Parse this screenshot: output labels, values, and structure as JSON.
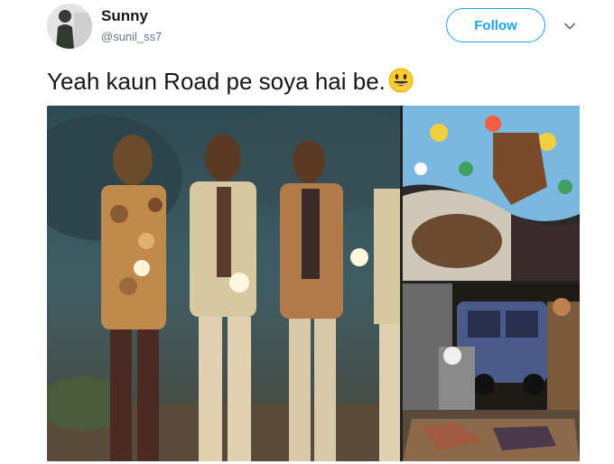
{
  "tweet": {
    "user": {
      "name": "Sunny",
      "handle": "@sunil_ss7"
    },
    "follow_label": "Follow",
    "text": "Yeah kaun Road pe soya hai be.",
    "emoji": "smiling-face-emoji",
    "media": [
      {
        "name": "movie-still-photo",
        "kind": "photo"
      },
      {
        "name": "sleeping-man-photo",
        "kind": "photo"
      },
      {
        "name": "night-street-photo",
        "kind": "photo"
      }
    ]
  },
  "colors": {
    "accent": "#1da1f2",
    "text": "#14171a",
    "secondary": "#657786"
  }
}
